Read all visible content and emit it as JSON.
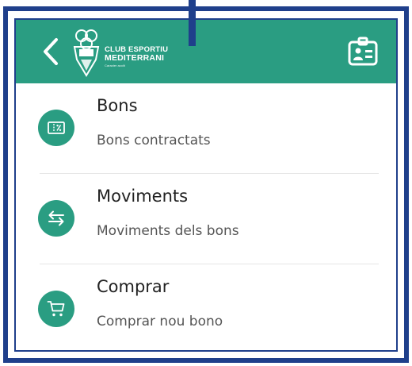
{
  "header": {
    "club_line1": "CLUB ESPORTIU",
    "club_line2": "MEDITERRANI",
    "club_line3": "Caracter acolit",
    "background_color": "#2a9d82",
    "back_icon": "chevron-left-icon",
    "card_icon": "id-card-icon"
  },
  "menu": {
    "items": [
      {
        "title": "Bons",
        "subtitle": "Bons contractats",
        "icon": "ticket-percent-icon"
      },
      {
        "title": "Moviments",
        "subtitle": "Moviments dels bons",
        "icon": "swap-arrows-icon"
      },
      {
        "title": "Comprar",
        "subtitle": "Comprar nou bono",
        "icon": "shopping-cart-icon"
      }
    ]
  },
  "colors": {
    "accent": "#2a9d82",
    "frame": "#1f3f8b"
  }
}
